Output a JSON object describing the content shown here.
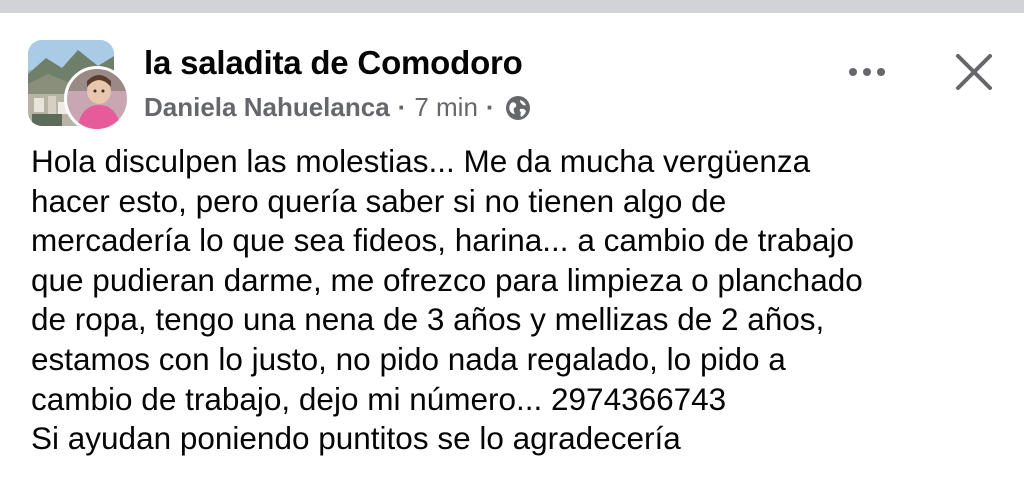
{
  "post": {
    "group_name": "la saladita de Comodoro",
    "author": "Daniela Nahuelanca",
    "separator": "·",
    "time": "7 min",
    "privacy_icon": "globe-icon",
    "more_icon": "more-dots-icon",
    "close_icon": "close-icon",
    "body_lines": [
      "Hola disculpen las molestias... Me da mucha vergüenza",
      "hacer esto, pero quería saber si no tienen algo de",
      "mercadería lo que sea fideos, harina... a cambio de trabajo",
      "que pudieran darme, me ofrezco para limpieza o planchado",
      "de ropa, tengo una nena de 3 años y mellizas de 2 años,",
      "estamos con lo justo, no pido nada regalado, lo pido a",
      "cambio de trabajo, dejo mi número... 2974366743",
      "Si ayudan poniendo puntitos se lo agradecería"
    ]
  },
  "colors": {
    "text": "#050505",
    "secondary_text": "#65676b",
    "divider": "#d1d3d6"
  }
}
